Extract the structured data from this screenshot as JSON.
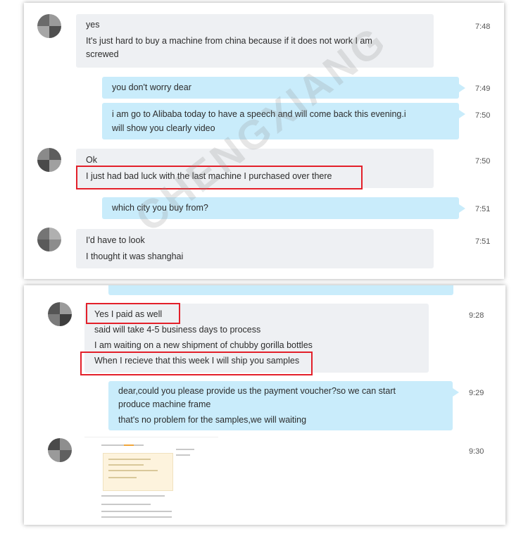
{
  "colors": {
    "incoming_bubble": "#eef0f3",
    "outgoing_bubble": "#c9ecfb",
    "highlight_box": "#e3202a"
  },
  "watermark": {
    "text": "CHENGXIANG"
  },
  "top_conversation": {
    "messages": [
      {
        "sender": "contact",
        "lines": [
          "yes",
          "It's just hard to buy a machine from china because if it does not work I am",
          "screwed"
        ],
        "time": "7:48"
      },
      {
        "sender": "me",
        "lines": [
          "you don't worry dear"
        ],
        "time": "7:49"
      },
      {
        "sender": "me",
        "lines": [
          "i am go to Alibaba today to have a speech and will come back this evening.i",
          "will show you clearly video"
        ],
        "time": "7:50"
      },
      {
        "sender": "contact",
        "lines": [
          "Ok",
          "I just had bad luck with the last machine I purchased over there"
        ],
        "time": "7:50"
      },
      {
        "sender": "me",
        "lines": [
          "which city you buy from?"
        ],
        "time": "7:51"
      },
      {
        "sender": "contact",
        "lines": [
          "I'd have to look",
          "I thought it was shanghai"
        ],
        "time": "7:51"
      }
    ]
  },
  "bottom_conversation": {
    "messages": [
      {
        "sender": "contact",
        "lines": [
          "Yes I paid as well",
          "said will take 4-5 business days to process",
          "I am waiting on a new shipment of chubby gorilla bottles",
          "When I recieve that this week I will ship you samples"
        ],
        "time": "9:28"
      },
      {
        "sender": "me",
        "lines": [
          "dear,could you please provide us the payment voucher?so we can start",
          "produce machine frame",
          "that's no problem for the samples,we will waiting"
        ],
        "time": "9:29"
      },
      {
        "sender": "contact",
        "attachment": "payment-voucher-screenshot",
        "time": "9:30"
      }
    ]
  }
}
